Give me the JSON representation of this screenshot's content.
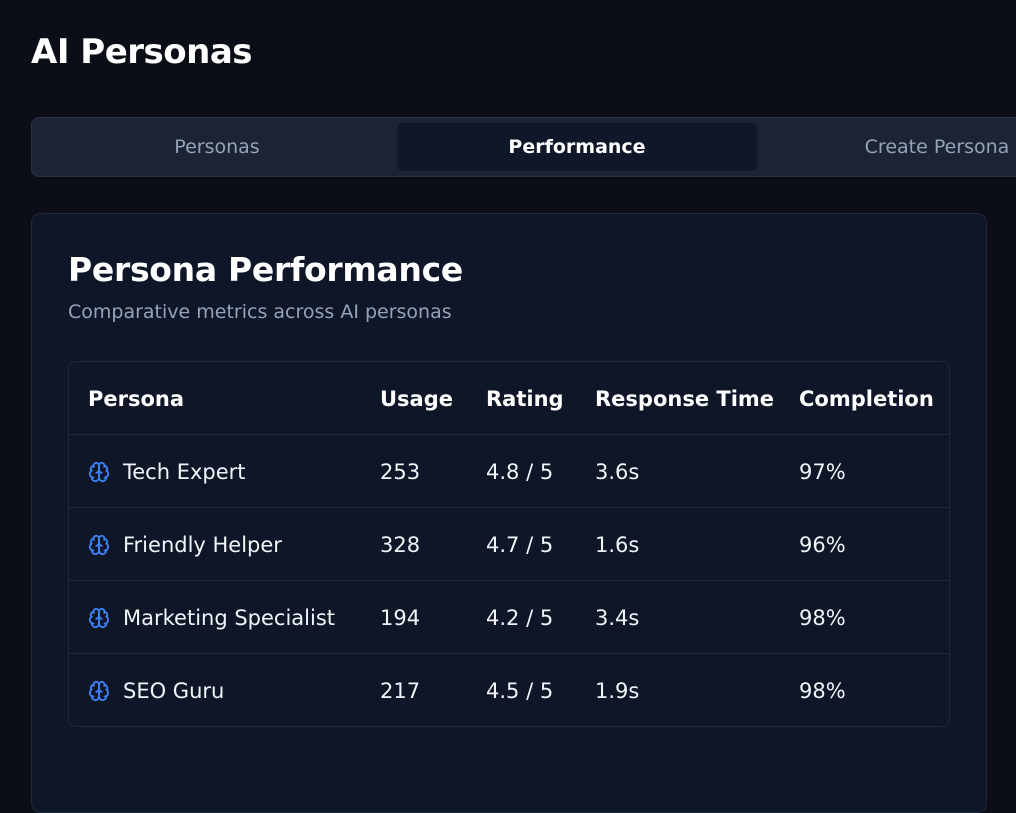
{
  "header": {
    "title": "AI Personas"
  },
  "tabs": [
    {
      "label": "Personas",
      "active": false
    },
    {
      "label": "Performance",
      "active": true
    },
    {
      "label": "Create Persona",
      "active": false
    }
  ],
  "card": {
    "title": "Persona Performance",
    "subtitle": "Comparative metrics across AI personas"
  },
  "table": {
    "columns": [
      "Persona",
      "Usage",
      "Rating",
      "Response Time",
      "Completion"
    ],
    "rows": [
      {
        "icon": "brain-icon",
        "persona": "Tech Expert",
        "usage": "253",
        "rating": "4.8 / 5",
        "response_time": "3.6s",
        "completion": "97%"
      },
      {
        "icon": "brain-icon",
        "persona": "Friendly Helper",
        "usage": "328",
        "rating": "4.7 / 5",
        "response_time": "1.6s",
        "completion": "96%"
      },
      {
        "icon": "brain-icon",
        "persona": "Marketing Specialist",
        "usage": "194",
        "rating": "4.2 / 5",
        "response_time": "3.4s",
        "completion": "98%"
      },
      {
        "icon": "brain-icon",
        "persona": "SEO Guru",
        "usage": "217",
        "rating": "4.5 / 5",
        "response_time": "1.9s",
        "completion": "98%"
      }
    ]
  },
  "colors": {
    "background": "#0b0e17",
    "card": "#0f1628",
    "tab_bar": "#1c2434",
    "accent_icon": "#3b82f6",
    "muted_text": "#94a3b8"
  }
}
